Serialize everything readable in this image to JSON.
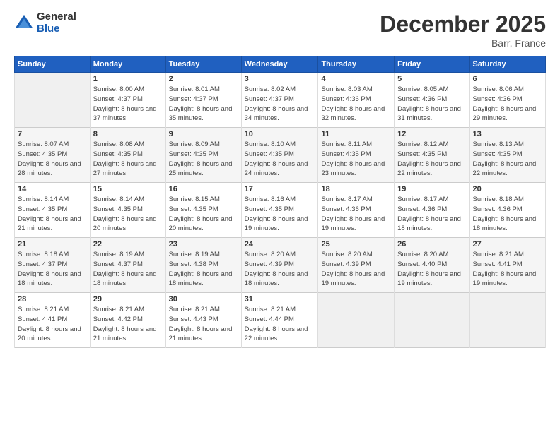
{
  "logo": {
    "general": "General",
    "blue": "Blue"
  },
  "title": "December 2025",
  "location": "Barr, France",
  "days_of_week": [
    "Sunday",
    "Monday",
    "Tuesday",
    "Wednesday",
    "Thursday",
    "Friday",
    "Saturday"
  ],
  "weeks": [
    [
      {
        "day": "",
        "sunrise": "",
        "sunset": "",
        "daylight": ""
      },
      {
        "day": "1",
        "sunrise": "Sunrise: 8:00 AM",
        "sunset": "Sunset: 4:37 PM",
        "daylight": "Daylight: 8 hours and 37 minutes."
      },
      {
        "day": "2",
        "sunrise": "Sunrise: 8:01 AM",
        "sunset": "Sunset: 4:37 PM",
        "daylight": "Daylight: 8 hours and 35 minutes."
      },
      {
        "day": "3",
        "sunrise": "Sunrise: 8:02 AM",
        "sunset": "Sunset: 4:37 PM",
        "daylight": "Daylight: 8 hours and 34 minutes."
      },
      {
        "day": "4",
        "sunrise": "Sunrise: 8:03 AM",
        "sunset": "Sunset: 4:36 PM",
        "daylight": "Daylight: 8 hours and 32 minutes."
      },
      {
        "day": "5",
        "sunrise": "Sunrise: 8:05 AM",
        "sunset": "Sunset: 4:36 PM",
        "daylight": "Daylight: 8 hours and 31 minutes."
      },
      {
        "day": "6",
        "sunrise": "Sunrise: 8:06 AM",
        "sunset": "Sunset: 4:36 PM",
        "daylight": "Daylight: 8 hours and 29 minutes."
      }
    ],
    [
      {
        "day": "7",
        "sunrise": "Sunrise: 8:07 AM",
        "sunset": "Sunset: 4:35 PM",
        "daylight": "Daylight: 8 hours and 28 minutes."
      },
      {
        "day": "8",
        "sunrise": "Sunrise: 8:08 AM",
        "sunset": "Sunset: 4:35 PM",
        "daylight": "Daylight: 8 hours and 27 minutes."
      },
      {
        "day": "9",
        "sunrise": "Sunrise: 8:09 AM",
        "sunset": "Sunset: 4:35 PM",
        "daylight": "Daylight: 8 hours and 25 minutes."
      },
      {
        "day": "10",
        "sunrise": "Sunrise: 8:10 AM",
        "sunset": "Sunset: 4:35 PM",
        "daylight": "Daylight: 8 hours and 24 minutes."
      },
      {
        "day": "11",
        "sunrise": "Sunrise: 8:11 AM",
        "sunset": "Sunset: 4:35 PM",
        "daylight": "Daylight: 8 hours and 23 minutes."
      },
      {
        "day": "12",
        "sunrise": "Sunrise: 8:12 AM",
        "sunset": "Sunset: 4:35 PM",
        "daylight": "Daylight: 8 hours and 22 minutes."
      },
      {
        "day": "13",
        "sunrise": "Sunrise: 8:13 AM",
        "sunset": "Sunset: 4:35 PM",
        "daylight": "Daylight: 8 hours and 22 minutes."
      }
    ],
    [
      {
        "day": "14",
        "sunrise": "Sunrise: 8:14 AM",
        "sunset": "Sunset: 4:35 PM",
        "daylight": "Daylight: 8 hours and 21 minutes."
      },
      {
        "day": "15",
        "sunrise": "Sunrise: 8:14 AM",
        "sunset": "Sunset: 4:35 PM",
        "daylight": "Daylight: 8 hours and 20 minutes."
      },
      {
        "day": "16",
        "sunrise": "Sunrise: 8:15 AM",
        "sunset": "Sunset: 4:35 PM",
        "daylight": "Daylight: 8 hours and 20 minutes."
      },
      {
        "day": "17",
        "sunrise": "Sunrise: 8:16 AM",
        "sunset": "Sunset: 4:35 PM",
        "daylight": "Daylight: 8 hours and 19 minutes."
      },
      {
        "day": "18",
        "sunrise": "Sunrise: 8:17 AM",
        "sunset": "Sunset: 4:36 PM",
        "daylight": "Daylight: 8 hours and 19 minutes."
      },
      {
        "day": "19",
        "sunrise": "Sunrise: 8:17 AM",
        "sunset": "Sunset: 4:36 PM",
        "daylight": "Daylight: 8 hours and 18 minutes."
      },
      {
        "day": "20",
        "sunrise": "Sunrise: 8:18 AM",
        "sunset": "Sunset: 4:36 PM",
        "daylight": "Daylight: 8 hours and 18 minutes."
      }
    ],
    [
      {
        "day": "21",
        "sunrise": "Sunrise: 8:18 AM",
        "sunset": "Sunset: 4:37 PM",
        "daylight": "Daylight: 8 hours and 18 minutes."
      },
      {
        "day": "22",
        "sunrise": "Sunrise: 8:19 AM",
        "sunset": "Sunset: 4:37 PM",
        "daylight": "Daylight: 8 hours and 18 minutes."
      },
      {
        "day": "23",
        "sunrise": "Sunrise: 8:19 AM",
        "sunset": "Sunset: 4:38 PM",
        "daylight": "Daylight: 8 hours and 18 minutes."
      },
      {
        "day": "24",
        "sunrise": "Sunrise: 8:20 AM",
        "sunset": "Sunset: 4:39 PM",
        "daylight": "Daylight: 8 hours and 18 minutes."
      },
      {
        "day": "25",
        "sunrise": "Sunrise: 8:20 AM",
        "sunset": "Sunset: 4:39 PM",
        "daylight": "Daylight: 8 hours and 19 minutes."
      },
      {
        "day": "26",
        "sunrise": "Sunrise: 8:20 AM",
        "sunset": "Sunset: 4:40 PM",
        "daylight": "Daylight: 8 hours and 19 minutes."
      },
      {
        "day": "27",
        "sunrise": "Sunrise: 8:21 AM",
        "sunset": "Sunset: 4:41 PM",
        "daylight": "Daylight: 8 hours and 19 minutes."
      }
    ],
    [
      {
        "day": "28",
        "sunrise": "Sunrise: 8:21 AM",
        "sunset": "Sunset: 4:41 PM",
        "daylight": "Daylight: 8 hours and 20 minutes."
      },
      {
        "day": "29",
        "sunrise": "Sunrise: 8:21 AM",
        "sunset": "Sunset: 4:42 PM",
        "daylight": "Daylight: 8 hours and 21 minutes."
      },
      {
        "day": "30",
        "sunrise": "Sunrise: 8:21 AM",
        "sunset": "Sunset: 4:43 PM",
        "daylight": "Daylight: 8 hours and 21 minutes."
      },
      {
        "day": "31",
        "sunrise": "Sunrise: 8:21 AM",
        "sunset": "Sunset: 4:44 PM",
        "daylight": "Daylight: 8 hours and 22 minutes."
      },
      {
        "day": "",
        "sunrise": "",
        "sunset": "",
        "daylight": ""
      },
      {
        "day": "",
        "sunrise": "",
        "sunset": "",
        "daylight": ""
      },
      {
        "day": "",
        "sunrise": "",
        "sunset": "",
        "daylight": ""
      }
    ]
  ]
}
